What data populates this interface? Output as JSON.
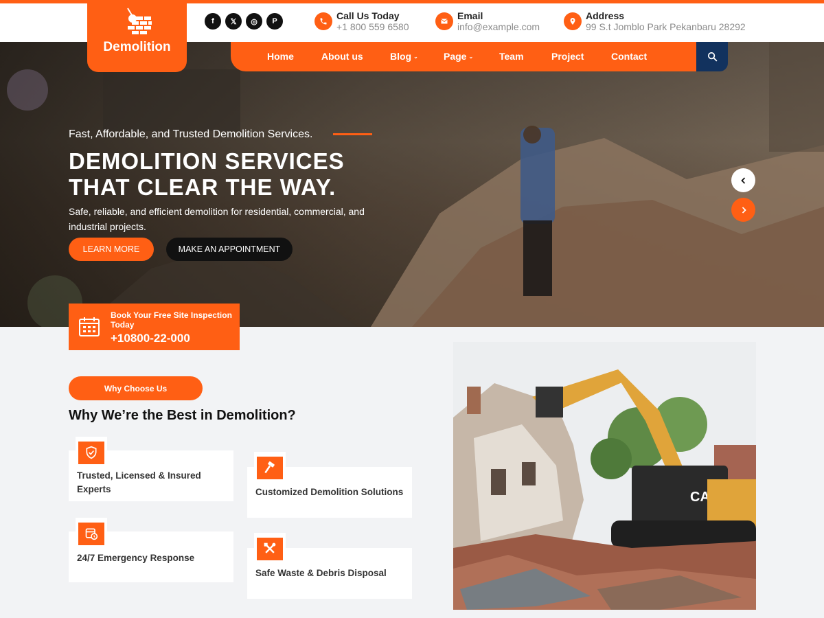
{
  "brand": {
    "name": "Demolition"
  },
  "social": [
    {
      "icon": "facebook-icon",
      "glyph": "f"
    },
    {
      "icon": "x-icon",
      "glyph": "𝕏"
    },
    {
      "icon": "instagram-icon",
      "glyph": "◎"
    },
    {
      "icon": "pinterest-icon",
      "glyph": "P"
    }
  ],
  "contacts": {
    "phone": {
      "title": "Call Us Today",
      "value": "+1 800 559 6580"
    },
    "email": {
      "title": "Email",
      "value": "info@example.com"
    },
    "address": {
      "title": "Address",
      "value": "99 S.t Jomblo Park Pekanbaru 28292"
    }
  },
  "nav": {
    "items": [
      {
        "label": "Home"
      },
      {
        "label": "About us"
      },
      {
        "label": "Blog",
        "dropdown": true
      },
      {
        "label": "Page",
        "dropdown": true
      },
      {
        "label": "Team"
      },
      {
        "label": "Project"
      },
      {
        "label": "Contact"
      }
    ]
  },
  "hero": {
    "tagline": "Fast, Affordable, and Trusted Demolition Services.",
    "title_line1": "DEMOLITION SERVICES",
    "title_line2": "THAT CLEAR THE WAY.",
    "subtitle": "Safe, reliable, and efficient demolition for residential, commercial, and industrial projects.",
    "learn_more": "LEARN MORE",
    "appointment": "MAKE AN APPOINTMENT"
  },
  "booking": {
    "text": "Book Your Free Site Inspection Today",
    "phone": "+10800-22-000"
  },
  "why": {
    "pill": "Why Choose Us",
    "title": "Why We’re the Best in Demolition?",
    "features": [
      {
        "label": "Trusted, Licensed & Insured Experts",
        "icon": "shield-check-icon"
      },
      {
        "label": "Customized Demolition Solutions",
        "icon": "hammer-icon"
      },
      {
        "label": "24/7 Emergency Response",
        "icon": "calendar-clock-icon"
      },
      {
        "label": "Safe Waste & Debris Disposal",
        "icon": "tools-icon"
      }
    ]
  },
  "colors": {
    "accent": "#ff5f14",
    "dark": "#111111",
    "navy": "#12325e",
    "background": "#f2f3f5"
  }
}
